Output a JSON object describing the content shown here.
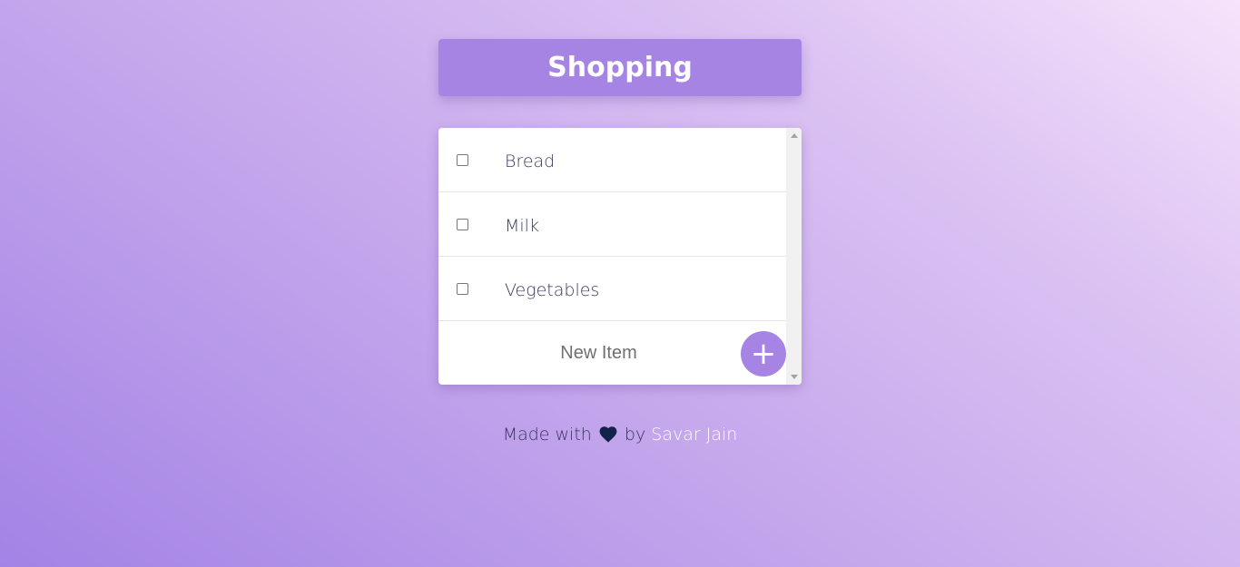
{
  "header": {
    "title": "Shopping"
  },
  "list": {
    "items": [
      {
        "label": "Bread",
        "checked": false
      },
      {
        "label": "Milk",
        "checked": false
      },
      {
        "label": "Vegetables",
        "checked": false
      }
    ],
    "new_item_placeholder": "New Item",
    "add_button_label": "+"
  },
  "footer": {
    "prefix": "Made with",
    "icon": "heart-icon",
    "by": "by",
    "author": "Savar Jain"
  },
  "colors": {
    "accent": "#a584e3",
    "heart": "#13214d",
    "text": "#3a3a5a"
  }
}
